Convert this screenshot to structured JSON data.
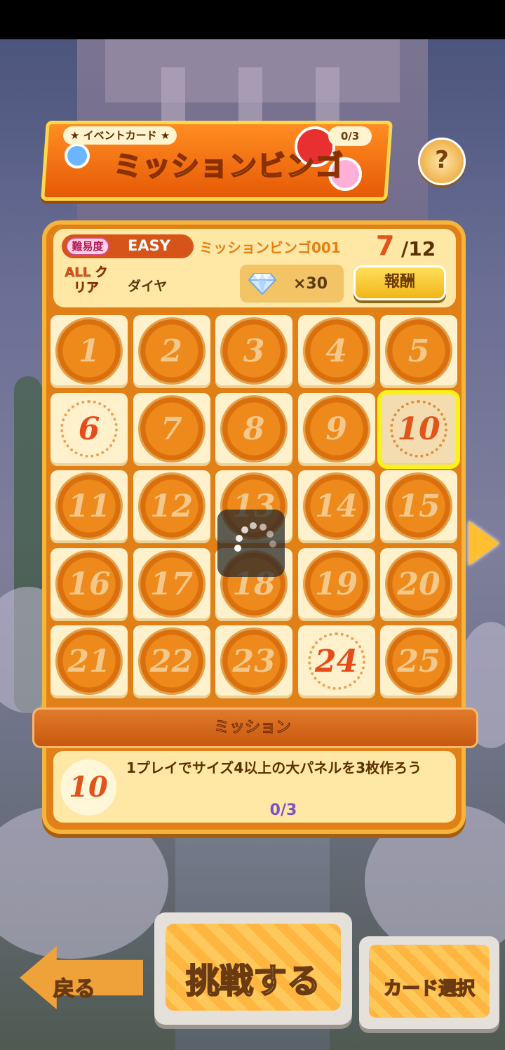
{
  "event": {
    "label": "★ イベントカード ★",
    "title": "ミッションビンゴ",
    "progress": "0/3",
    "help_glyph": "?"
  },
  "card": {
    "difficulty_label": "難易度",
    "difficulty": "EASY",
    "name": "ミッションビンゴ001",
    "cleared_count": "7",
    "total_count": "/12",
    "allclear_label": "ALL クリア",
    "reward_name": "ダイヤ",
    "reward_qty": "×30",
    "reward_button": "報酬"
  },
  "grid": {
    "cells": [
      "1",
      "2",
      "3",
      "4",
      "5",
      "6",
      "7",
      "8",
      "9",
      "10",
      "11",
      "12",
      "13",
      "14",
      "15",
      "16",
      "17",
      "18",
      "19",
      "20",
      "21",
      "22",
      "23",
      "24",
      "25"
    ],
    "cleared": [
      "6",
      "24"
    ],
    "selected": "10"
  },
  "mission": {
    "title": "ミッション",
    "number": "10",
    "description": "1プレイでサイズ4以上の大パネルを3枚作ろう",
    "progress": "0/3"
  },
  "buttons": {
    "back": "戻る",
    "challenge": "挑戦する",
    "card_select": "カード選択"
  },
  "colors": {
    "accent": "#e08016",
    "selected_outline": "#f8f21a",
    "cleared_number": "#e54c1a"
  }
}
